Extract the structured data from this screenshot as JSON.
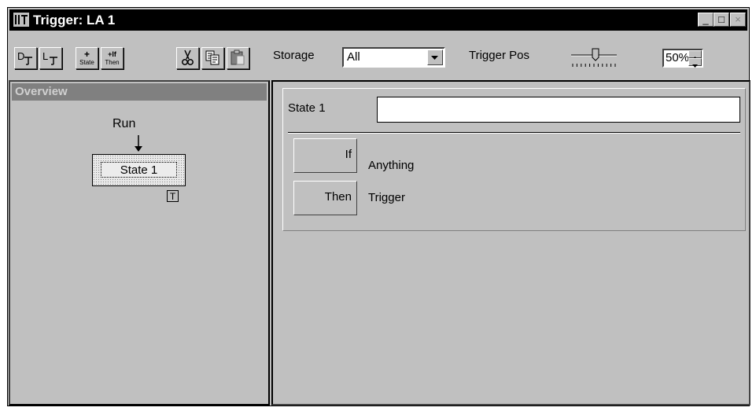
{
  "window": {
    "title": "Trigger: LA 1"
  },
  "title_buttons": {
    "minimize": "_",
    "maximize": "□",
    "close": "×"
  },
  "toolbar": {
    "btn_state_add_top": "+",
    "btn_state_add_bottom": "State",
    "btn_ifthen_add_top": "+If",
    "btn_ifthen_add_bottom": "Then",
    "storage_label": "Storage",
    "storage_value": "All",
    "trigger_pos_label": "Trigger Pos",
    "trigger_pos_value": "50%",
    "trigger_pos_fraction": 0.5
  },
  "overview": {
    "header": "Overview",
    "run_label": "Run",
    "state_label": "State 1",
    "trigger_badge": "T"
  },
  "editor": {
    "state_label": "State 1",
    "state_name_value": "",
    "if_label": "If",
    "if_value": "Anything",
    "then_label": "Then",
    "then_value": "Trigger"
  }
}
